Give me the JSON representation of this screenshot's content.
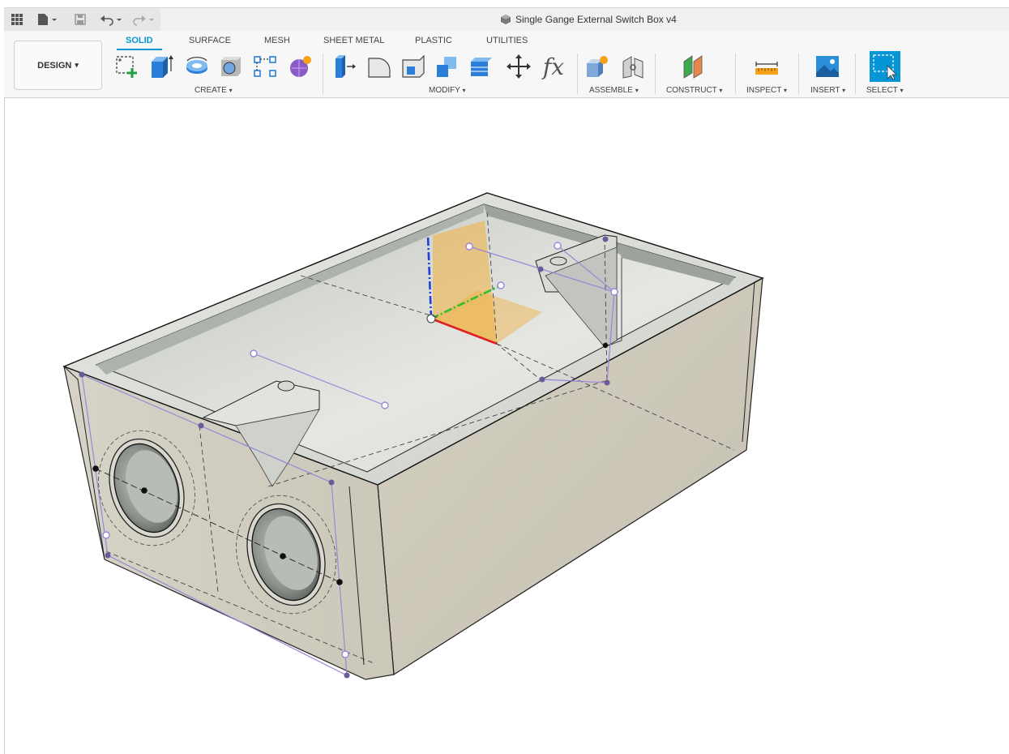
{
  "app_bar": {
    "document_title": "Single Gange External Switch Box v4",
    "quick_access": [
      {
        "name": "grid-icon"
      },
      {
        "name": "file-icon"
      },
      {
        "name": "save-icon"
      },
      {
        "name": "undo-icon"
      },
      {
        "name": "redo-icon"
      }
    ]
  },
  "workspace": {
    "label": "DESIGN"
  },
  "tabs": [
    {
      "label": "SOLID",
      "active": true
    },
    {
      "label": "SURFACE"
    },
    {
      "label": "MESH"
    },
    {
      "label": "SHEET METAL"
    },
    {
      "label": "PLASTIC"
    },
    {
      "label": "UTILITIES"
    }
  ],
  "groups": {
    "create": "CREATE",
    "modify": "MODIFY",
    "assemble": "ASSEMBLE",
    "construct": "CONSTRUCT",
    "inspect": "INSPECT",
    "insert": "INSERT",
    "select": "SELECT"
  },
  "tools": {
    "create": [
      "create-sketch-icon",
      "extrude-icon",
      "revolve-icon",
      "hole-icon",
      "pattern-icon",
      "create-form-icon"
    ],
    "modify": [
      "press-pull-icon",
      "fillet-icon",
      "chamfer-icon",
      "combine-icon",
      "shell-icon",
      "move-icon",
      "parameters-icon"
    ],
    "assemble": [
      "new-component-icon",
      "joint-icon"
    ],
    "construct": [
      "offset-plane-icon"
    ],
    "inspect": [
      "measure-icon"
    ],
    "insert": [
      "insert-image-icon"
    ],
    "select": [
      "select-icon"
    ]
  },
  "glyphs": {
    "fx": "fx",
    "dropdown": "▾"
  },
  "colors": {
    "accent": "#0696d7",
    "model_top": "#d9dbd5",
    "model_side": "#cfccbe",
    "sketch": "#9a86d8",
    "x_axis": "#e02020",
    "y_axis": "#2fbf2f",
    "z_axis": "#1f3fd8",
    "plane": "#f0b040"
  }
}
